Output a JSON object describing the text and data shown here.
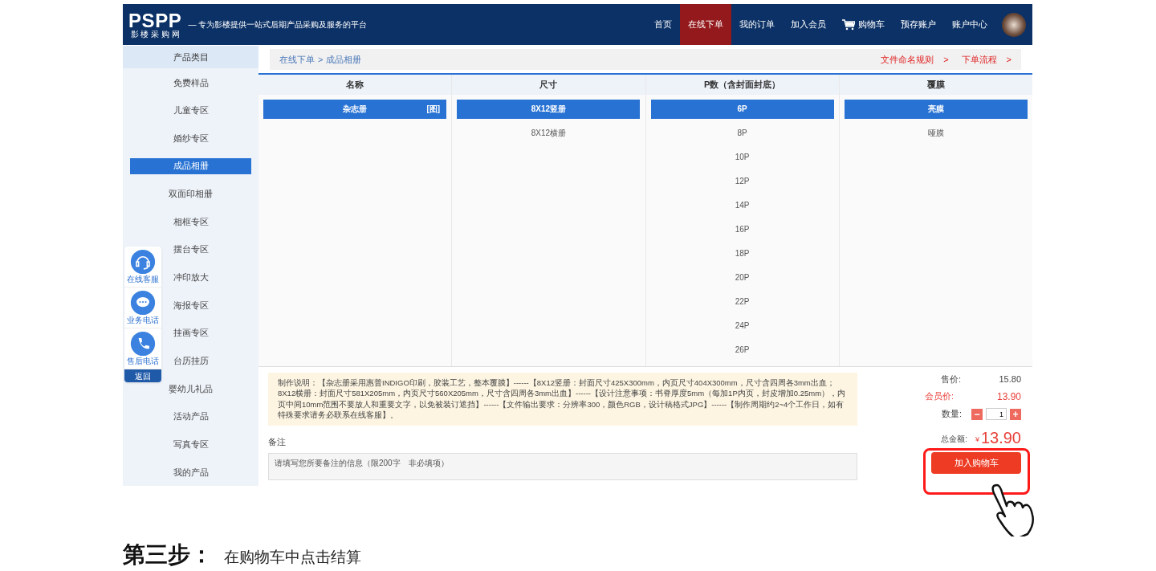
{
  "header": {
    "logo": "PSPP",
    "logo_sub": "影 楼 采 购 网",
    "tagline": "— 专为影楼提供一站式后期产品采购及服务的平台",
    "nav": [
      {
        "label": "首页",
        "selected": false,
        "kind": "link"
      },
      {
        "label": "在线下单",
        "selected": true,
        "kind": "link"
      },
      {
        "label": "我的订单",
        "selected": false,
        "kind": "link"
      },
      {
        "label": "加入会员",
        "selected": false,
        "kind": "link"
      },
      {
        "label": "购物车",
        "selected": false,
        "kind": "cart"
      },
      {
        "label": "预存账户",
        "selected": false,
        "kind": "link"
      },
      {
        "label": "账户中心",
        "selected": false,
        "kind": "link"
      }
    ]
  },
  "sidebar": {
    "title": "产品类目",
    "items": [
      {
        "label": "免费样品",
        "selected": false
      },
      {
        "label": "儿童专区",
        "selected": false
      },
      {
        "label": "婚纱专区",
        "selected": false
      },
      {
        "label": "成品相册",
        "selected": true
      },
      {
        "label": "双面印相册",
        "selected": false
      },
      {
        "label": "相框专区",
        "selected": false
      },
      {
        "label": "摆台专区",
        "selected": false
      },
      {
        "label": "冲印放大",
        "selected": false
      },
      {
        "label": "海报专区",
        "selected": false
      },
      {
        "label": "挂画专区",
        "selected": false
      },
      {
        "label": "台历挂历",
        "selected": false
      },
      {
        "label": "婴幼儿礼品",
        "selected": false
      },
      {
        "label": "活动产品",
        "selected": false
      },
      {
        "label": "写真专区",
        "selected": false
      },
      {
        "label": "我的产品",
        "selected": false
      }
    ]
  },
  "float_widget": {
    "items": [
      {
        "label": "在线客服",
        "kind": "headset"
      },
      {
        "label": "业务电话",
        "kind": "chat"
      },
      {
        "label": "售后电话",
        "kind": "phone"
      }
    ],
    "back_label": "返回"
  },
  "breadcrumb": {
    "items": [
      "在线下单",
      "成品相册"
    ],
    "separator": ">",
    "links": [
      {
        "label": "文件命名规则",
        "arrow": ">"
      },
      {
        "label": "下单流程",
        "arrow": ">"
      }
    ]
  },
  "columns": [
    {
      "title": "名称",
      "options": [
        {
          "label": "杂志册",
          "tag": "[图]",
          "selected": true
        }
      ]
    },
    {
      "title": "尺寸",
      "options": [
        {
          "label": "8X12竖册",
          "selected": true
        },
        {
          "label": "8X12横册",
          "selected": false
        }
      ]
    },
    {
      "title": "P数（含封面封底）",
      "options": [
        {
          "label": "6P",
          "selected": true
        },
        {
          "label": "8P",
          "selected": false
        },
        {
          "label": "10P",
          "selected": false
        },
        {
          "label": "12P",
          "selected": false
        },
        {
          "label": "14P",
          "selected": false
        },
        {
          "label": "16P",
          "selected": false
        },
        {
          "label": "18P",
          "selected": false
        },
        {
          "label": "20P",
          "selected": false
        },
        {
          "label": "22P",
          "selected": false
        },
        {
          "label": "24P",
          "selected": false
        },
        {
          "label": "26P",
          "selected": false
        }
      ]
    },
    {
      "title": "覆膜",
      "options": [
        {
          "label": "亮膜",
          "selected": true
        },
        {
          "label": "哑膜",
          "selected": false
        }
      ]
    }
  ],
  "description": "制作说明：【杂志册采用惠普INDIGO印刷，胶装工艺，整本覆膜】------【8X12竖册：封面尺寸425X300mm，内页尺寸404X300mm，尺寸含四周各3mm出血；8X12横册：封面尺寸581X205mm，内页尺寸560X205mm，尺寸含四周各3mm出血】------【设计注意事项：书脊厚度5mm（每加1P内页，封皮增加0.25mm），内页中间10mm范围不要放人和重要文字，以免被装订遮挡】------【文件输出要求：分辨率300，颜色RGB，设计稿格式JPG】------【制作周期约2~4个工作日，如有特殊要求请务必联系在线客服】。",
  "remark": {
    "label": "备注",
    "placeholder": "请填写您所要备注的信息（限200字　非必填项）"
  },
  "pricing": {
    "price_label": "售价:",
    "price": "15.80",
    "member_label": "会员价:",
    "member_price": "13.90",
    "qty_label": "数量:",
    "minus": "−",
    "qty": "1",
    "plus": "+",
    "total_label": "总金额:",
    "currency": "¥",
    "total": "13.90",
    "cart_button": "加入购物车"
  },
  "step": {
    "title": "第三步：",
    "text": "在购物车中点击结算"
  }
}
